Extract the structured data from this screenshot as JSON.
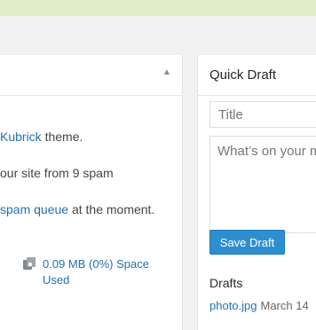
{
  "activity": {
    "theme_link": "Kubrick",
    "theme_suffix": " theme.",
    "spam_line": "our site from 9 spam",
    "spam_queue_link": "spam queue",
    "spam_queue_suffix": " at the moment.",
    "space_used": "0.09 MB (0%) Space Used",
    "toggle_icon": "triangle-up-icon"
  },
  "quick_draft": {
    "title": "Quick Draft",
    "title_placeholder": "Title",
    "content_placeholder": "What’s on your m",
    "save_label": "Save Draft",
    "drafts_heading": "Drafts",
    "drafts": [
      {
        "title": "photo.jpg",
        "date": "March 14"
      }
    ]
  },
  "colors": {
    "link": "#2271b1",
    "button": "#2d8fd0",
    "topbar": "#e1edc9"
  }
}
